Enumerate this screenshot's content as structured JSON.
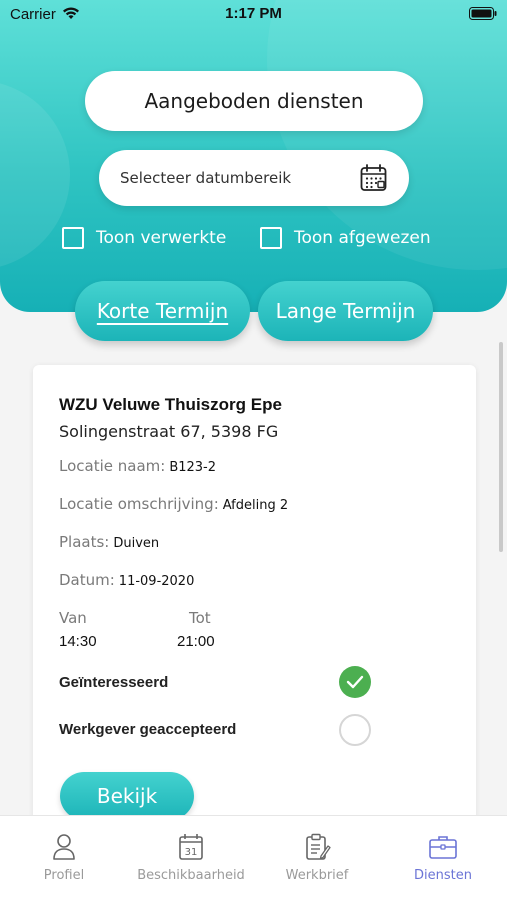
{
  "status_bar": {
    "carrier": "Carrier",
    "time": "1:17 PM"
  },
  "header": {
    "title": "Aangeboden diensten",
    "date_range_placeholder": "Selecteer datumbereik",
    "filters": [
      {
        "label": "Toon verwerkte",
        "checked": false
      },
      {
        "label": "Toon afgewezen",
        "checked": false
      }
    ],
    "tabs": [
      {
        "label": "Korte Termijn",
        "active": true
      },
      {
        "label": "Lange Termijn",
        "active": false
      }
    ]
  },
  "card": {
    "organization": "WZU Veluwe Thuiszorg Epe",
    "address": "Solingenstraat 67, 5398 FG",
    "fields": [
      {
        "label": "Locatie naam:",
        "value": "B123-2"
      },
      {
        "label": "Locatie omschrijving:",
        "value": "Afdeling 2"
      },
      {
        "label": "Plaats:",
        "value": "Duiven"
      },
      {
        "label": "Datum:",
        "value": "11-09-2020"
      }
    ],
    "van_label": "Van",
    "tot_label": "Tot",
    "van_value": "14:30",
    "tot_value": "21:00",
    "statuses": [
      {
        "label": "Geïnteresseerd",
        "checked": true
      },
      {
        "label": "Werkgever geaccepteerd",
        "checked": false
      }
    ],
    "view_button": "Bekijk"
  },
  "bottom_nav": [
    {
      "label": "Profiel",
      "icon": "user-icon",
      "active": false
    },
    {
      "label": "Beschikbaarheid",
      "icon": "calendar-31-icon",
      "active": false
    },
    {
      "label": "Werkbrief",
      "icon": "clipboard-icon",
      "active": false
    },
    {
      "label": "Diensten",
      "icon": "briefcase-icon",
      "active": true
    }
  ],
  "colors": {
    "accent": "#1cb4b8",
    "header_top": "#5fe0d8",
    "check_green": "#4caf50",
    "nav_active": "#6b74d6"
  }
}
